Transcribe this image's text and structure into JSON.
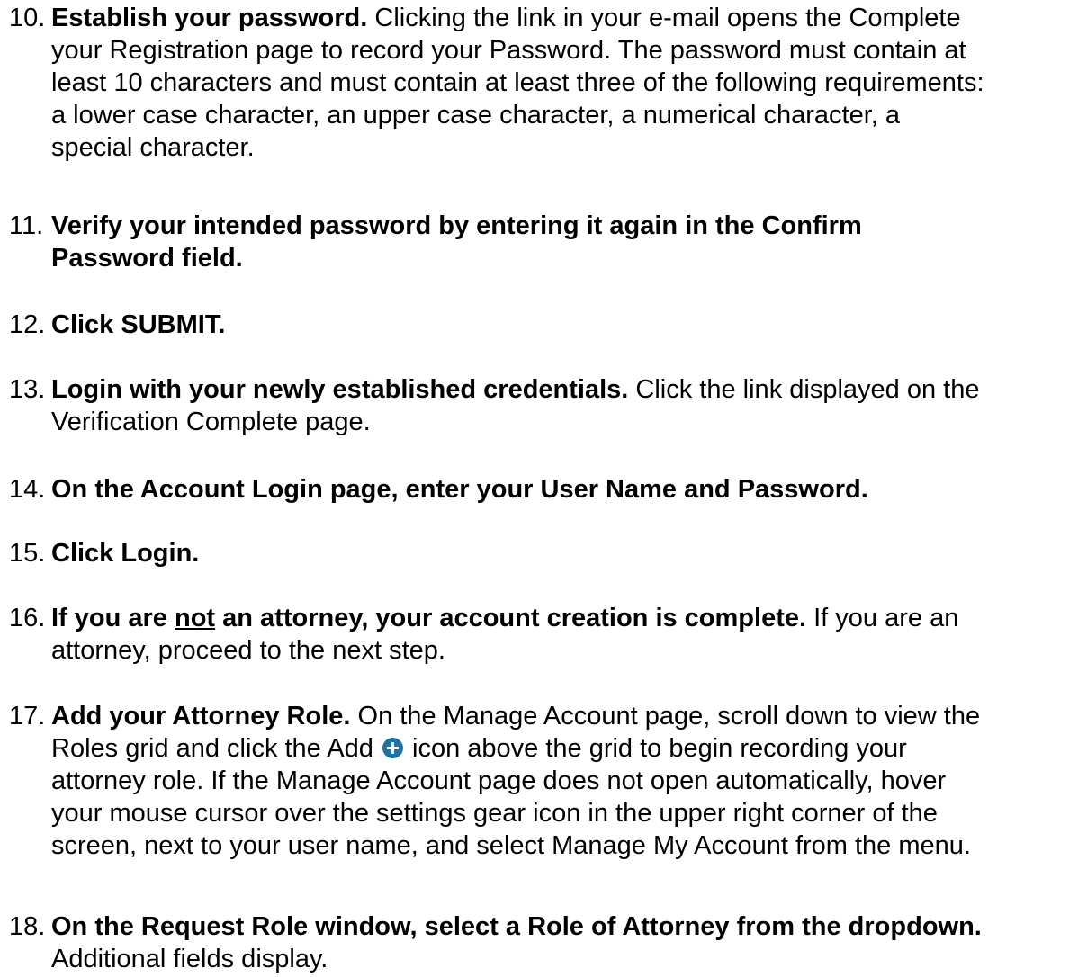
{
  "steps": [
    {
      "num": "10.",
      "lines": [
        {
          "bold": "Establish your password.",
          "text": " Clicking the link in your e-mail opens the Complete"
        },
        {
          "text": "your Registration page to record your Password. The password must contain at"
        },
        {
          "text": "least 10 characters and must contain at least three of the following requirements:"
        },
        {
          "text": "a lower case character, an upper case character, a numerical character, a"
        },
        {
          "text": "special character."
        }
      ]
    },
    {
      "num": "11.",
      "lines": [
        {
          "bold": "Verify your intended password by entering it again in the Confirm"
        },
        {
          "bold": "Password field."
        }
      ]
    },
    {
      "num": "12.",
      "lines": [
        {
          "bold": "Click SUBMIT."
        }
      ]
    },
    {
      "num": "13.",
      "lines": [
        {
          "bold": "Login with your newly established credentials.",
          "text": " Click the link displayed on the"
        },
        {
          "text": "Verification Complete page."
        }
      ]
    },
    {
      "num": "14.",
      "lines": [
        {
          "bold": "On the Account Login page, enter your User Name and Password."
        }
      ]
    },
    {
      "num": "15.",
      "lines": [
        {
          "bold": "Click Login."
        }
      ]
    },
    {
      "num": "16.",
      "lines": [
        {
          "bold_pre": "If you are ",
          "bold_u": "not",
          "bold": " an attorney, your account creation is complete.",
          "text": " If you are an"
        },
        {
          "text": "attorney, proceed to the next step."
        }
      ]
    },
    {
      "num": "17.",
      "lines": [
        {
          "bold": "Add your Attorney Role.",
          "text": " On the Manage Account page, scroll down to view the"
        },
        {
          "text": "Roles grid and click the Add",
          "icon": "add-circle-icon",
          "text_after": " icon above the grid to begin recording your"
        },
        {
          "text": "attorney role. If the Manage Account page does not open automatically, hover"
        },
        {
          "text": "your mouse cursor over the settings gear icon in the upper right corner of the"
        },
        {
          "text": "screen, next to your user name, and select Manage My Account from the menu."
        }
      ]
    },
    {
      "num": "18.",
      "lines": [
        {
          "bold": "On the Request Role window, select a Role of Attorney from the dropdown."
        },
        {
          "text": "Additional fields display."
        }
      ]
    }
  ],
  "colors": {
    "text": "#000000",
    "background": "#ffffff",
    "icon": "#1a73a8"
  }
}
